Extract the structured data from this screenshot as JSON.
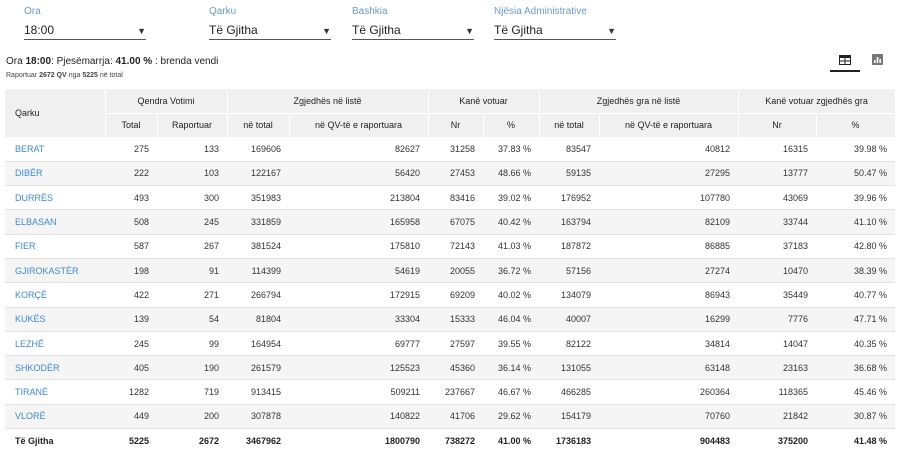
{
  "filters": [
    {
      "label": "Ora",
      "value": "18:00"
    },
    {
      "label": "Qarku",
      "value": "Të Gjitha"
    },
    {
      "label": "Bashkia",
      "value": "Të Gjitha"
    },
    {
      "label": "Njësia Administrative",
      "value": "Të Gjitha"
    }
  ],
  "summary": {
    "prefix": "Ora",
    "time": "18:00",
    "mid": ": Pjesëmarrja:",
    "participation": "41.00 %",
    "suffix": ": brenda vendi",
    "reported_prefix": "Raportuar",
    "reported": "2672 QV",
    "reported_mid": "nga",
    "total": "5225",
    "reported_suffix": "në total"
  },
  "view": {
    "table_icon": "table-icon",
    "chart_icon": "chart-icon",
    "active": "table"
  },
  "table": {
    "headers": {
      "qarku": "Qarku",
      "qv": "Qendra Votimi",
      "zgj": "Zgjedhës në listë",
      "kv": "Kanë votuar",
      "zgj_gra": "Zgjedhës gra në listë",
      "kv_gra": "Kanë votuar zgjedhës gra",
      "total": "Total",
      "raportuar": "Raportuar",
      "ne_total": "në total",
      "ne_qv": "në QV-të e raportuara",
      "nr": "Nr",
      "pct": "%",
      "ne_total2": "në total",
      "ne_qv2": "në QV-të e raportuara",
      "nr2": "Nr",
      "pct2": "%"
    },
    "rows": [
      [
        "BERAT",
        "275",
        "133",
        "169606",
        "82627",
        "31258",
        "37.83 %",
        "83547",
        "40812",
        "16315",
        "39.98 %"
      ],
      [
        "DIBËR",
        "222",
        "103",
        "122167",
        "56420",
        "27453",
        "48.66 %",
        "59135",
        "27295",
        "13777",
        "50.47 %"
      ],
      [
        "DURRËS",
        "493",
        "300",
        "351983",
        "213804",
        "83416",
        "39.02 %",
        "176952",
        "107780",
        "43069",
        "39.96 %"
      ],
      [
        "ELBASAN",
        "508",
        "245",
        "331859",
        "165958",
        "67075",
        "40.42 %",
        "163794",
        "82109",
        "33744",
        "41.10 %"
      ],
      [
        "FIER",
        "587",
        "267",
        "381524",
        "175810",
        "72143",
        "41.03 %",
        "187872",
        "86885",
        "37183",
        "42.80 %"
      ],
      [
        "GJIROKASTËR",
        "198",
        "91",
        "114399",
        "54619",
        "20055",
        "36.72 %",
        "57156",
        "27274",
        "10470",
        "38.39 %"
      ],
      [
        "KORÇË",
        "422",
        "271",
        "266794",
        "172915",
        "69209",
        "40.02 %",
        "134079",
        "86943",
        "35449",
        "40.77 %"
      ],
      [
        "KUKËS",
        "139",
        "54",
        "81804",
        "33304",
        "15333",
        "46.04 %",
        "40007",
        "16299",
        "7776",
        "47.71 %"
      ],
      [
        "LEZHË",
        "245",
        "99",
        "164954",
        "69777",
        "27597",
        "39.55 %",
        "82122",
        "34814",
        "14047",
        "40.35 %"
      ],
      [
        "SHKODËR",
        "405",
        "190",
        "261579",
        "125523",
        "45360",
        "36.14 %",
        "131055",
        "63148",
        "23163",
        "36.68 %"
      ],
      [
        "TIRANË",
        "1282",
        "719",
        "913415",
        "509211",
        "237667",
        "46.67 %",
        "466285",
        "260364",
        "118365",
        "45.46 %"
      ],
      [
        "VLORË",
        "449",
        "200",
        "307878",
        "140822",
        "41706",
        "29.62 %",
        "154179",
        "70760",
        "21842",
        "30.87 %"
      ]
    ],
    "total": [
      "Të Gjitha",
      "5225",
      "2672",
      "3467962",
      "1800790",
      "738272",
      "41.00 %",
      "1736183",
      "904483",
      "375200",
      "41.48 %"
    ]
  }
}
